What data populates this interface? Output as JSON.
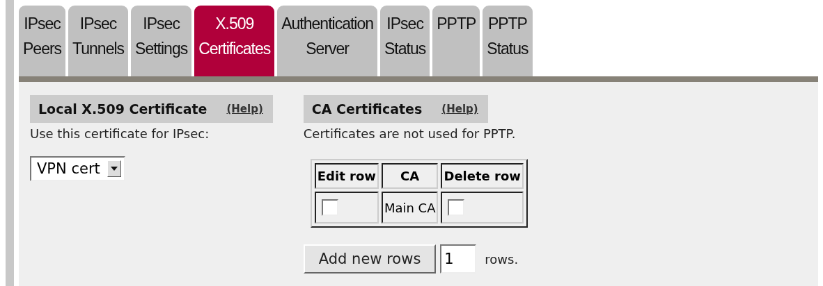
{
  "tabs": [
    {
      "lines": [
        "IPsec",
        "Peers"
      ],
      "selected": false
    },
    {
      "lines": [
        "IPsec",
        "Tunnels"
      ],
      "selected": false
    },
    {
      "lines": [
        "IPsec",
        "Settings"
      ],
      "selected": false
    },
    {
      "lines": [
        "X.509",
        "Certificates"
      ],
      "selected": true
    },
    {
      "lines": [
        "Authentication",
        "Server"
      ],
      "selected": false
    },
    {
      "lines": [
        "IPsec",
        "Status"
      ],
      "selected": false
    },
    {
      "lines": [
        "PPTP"
      ],
      "selected": false
    },
    {
      "lines": [
        "PPTP",
        "Status"
      ],
      "selected": false
    }
  ],
  "local": {
    "title": "Local X.509 Certificate",
    "help": "(Help)",
    "label": "Use this certificate for IPsec:",
    "select": {
      "value": "VPN cert"
    }
  },
  "ca": {
    "title": "CA Certificates",
    "help": "(Help)",
    "note": "Certificates are not used for PPTP.",
    "table": {
      "columns": [
        "Edit row",
        "CA",
        "Delete row"
      ],
      "rows": [
        {
          "edit": {
            "checked": false
          },
          "ca": "Main CA",
          "delete": {
            "checked": false
          }
        }
      ]
    },
    "add_button": "Add new rows",
    "rows_input": {
      "value": "1"
    },
    "rows_suffix": "rows."
  }
}
